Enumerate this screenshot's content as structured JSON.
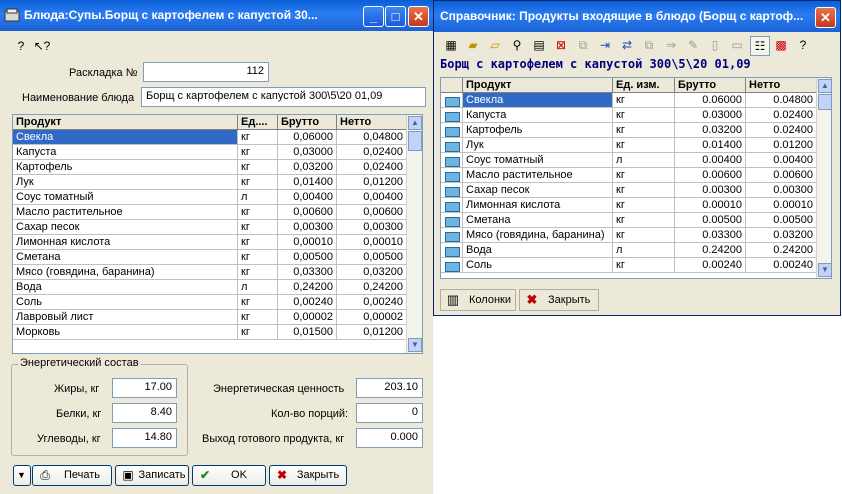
{
  "win1": {
    "title": "Блюда:Супы.Борщ с  картофелем  с капустой 30...",
    "toolbar": {
      "help_icon": "?",
      "whatsthis_icon": "↖?"
    },
    "raskladka_label": "Раскладка №",
    "raskladka_value": "112",
    "name_label": "Наименование блюда",
    "name_value": "Борщ с  картофелем  с капустой 300\\5\\20 01,09",
    "grid": {
      "headers": [
        "Продукт",
        "Ед....",
        "Брутто",
        "Нетто"
      ],
      "rows": [
        [
          "Свекла",
          "кг",
          "0,06000",
          "0,04800"
        ],
        [
          "Капуста",
          "кг",
          "0,03000",
          "0,02400"
        ],
        [
          "Картофель",
          "кг",
          "0,03200",
          "0,02400"
        ],
        [
          "Лук",
          "кг",
          "0,01400",
          "0,01200"
        ],
        [
          "Соус томатный",
          "л",
          "0,00400",
          "0,00400"
        ],
        [
          "Масло растительное",
          "кг",
          "0,00600",
          "0,00600"
        ],
        [
          "Сахар песок",
          "кг",
          "0,00300",
          "0,00300"
        ],
        [
          "Лимонная кислота",
          "кг",
          "0,00010",
          "0,00010"
        ],
        [
          "Сметана",
          "кг",
          "0,00500",
          "0,00500"
        ],
        [
          "Мясо (говядина, баранина)",
          "кг",
          "0,03300",
          "0,03200"
        ],
        [
          "Вода",
          "л",
          "0,24200",
          "0,24200"
        ],
        [
          "Соль",
          "кг",
          "0,00240",
          "0,00240"
        ],
        [
          "Лавровый лист",
          "кг",
          "0,00002",
          "0,00002"
        ],
        [
          "Морковь",
          "кг",
          "0,01500",
          "0,01200"
        ]
      ]
    },
    "energy": {
      "group_label": "Энергетический состав",
      "fat_label": "Жиры, кг",
      "fat_value": "17.00",
      "protein_label": "Белки, кг",
      "protein_value": "8.40",
      "carbs_label": "Углеводы, кг",
      "carbs_value": "14.80",
      "value_label": "Энергетическая ценность",
      "value_value": "203.10",
      "portions_label": "Кол-во порций:",
      "portions_value": "0",
      "yield_label": "Выход готового продукта, кг",
      "yield_value": "0.000"
    },
    "buttons": {
      "print": "Печать",
      "save": "Записать",
      "ok": "OK",
      "close": "Закрыть"
    }
  },
  "win2": {
    "title": "Справочник: Продукты входящие в блюдо (Борщ с  картоф...",
    "subtitle": "Борщ с  картофелем  с капустой 300\\5\\20 01,09",
    "grid": {
      "headers": [
        "Продукт",
        "Ед. изм.",
        "Брутто",
        "Нетто"
      ],
      "rows": [
        [
          "Свекла",
          "кг",
          "0.06000",
          "0.04800"
        ],
        [
          "Капуста",
          "кг",
          "0.03000",
          "0.02400"
        ],
        [
          "Картофель",
          "кг",
          "0.03200",
          "0.02400"
        ],
        [
          "Лук",
          "кг",
          "0.01400",
          "0.01200"
        ],
        [
          "Соус томатный",
          "л",
          "0.00400",
          "0.00400"
        ],
        [
          "Масло растительное",
          "кг",
          "0.00600",
          "0.00600"
        ],
        [
          "Сахар песок",
          "кг",
          "0.00300",
          "0.00300"
        ],
        [
          "Лимонная кислота",
          "кг",
          "0.00010",
          "0.00010"
        ],
        [
          "Сметана",
          "кг",
          "0.00500",
          "0.00500"
        ],
        [
          "Мясо (говядина, баранина)",
          "кг",
          "0.03300",
          "0.03200"
        ],
        [
          "Вода",
          "л",
          "0.24200",
          "0.24200"
        ],
        [
          "Соль",
          "кг",
          "0.00240",
          "0.00240"
        ]
      ]
    },
    "buttons": {
      "columns": "Колонки",
      "close": "Закрыть"
    }
  }
}
